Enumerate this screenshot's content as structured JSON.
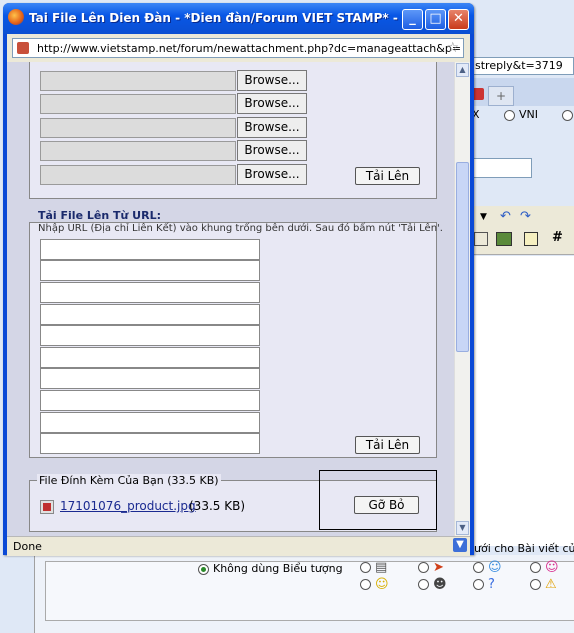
{
  "popup": {
    "title": "Tai File Lên Dien Đàn - *Dien đàn/Forum VIET STAMP* - Mozi...",
    "url": "http://www.vietstamp.net/forum/newattachment.php?dc=manageattach&p=",
    "status": "Done",
    "controls": {
      "minimize": "_",
      "maximize": "□",
      "close": "✕"
    }
  },
  "upload_files": {
    "browse_label": "Browse...",
    "rows": 5,
    "upload_label": "Tải Lên"
  },
  "upload_url": {
    "title": "Tải File Lên Từ URL:",
    "hint": "Nhập URL (Địa chỉ Liên Kết) vào khung trống bên dưới. Sau đó bấm nút 'Tải Lên'.",
    "rows": 10,
    "upload_label": "Tải Lên"
  },
  "attachments": {
    "legend": "File Đính Kèm Của Bạn (33.5 KB)",
    "file_name": "17101076_product.jpg",
    "file_size": "(33.5 KB)",
    "remove_label": "Gỡ Bỏ"
  },
  "background": {
    "url_fragment": "streply&t=3719",
    "radio_label": "VNI",
    "note": "ưới cho Bài viết củ",
    "no_icon_label": "Không dùng Biểu tượng"
  }
}
